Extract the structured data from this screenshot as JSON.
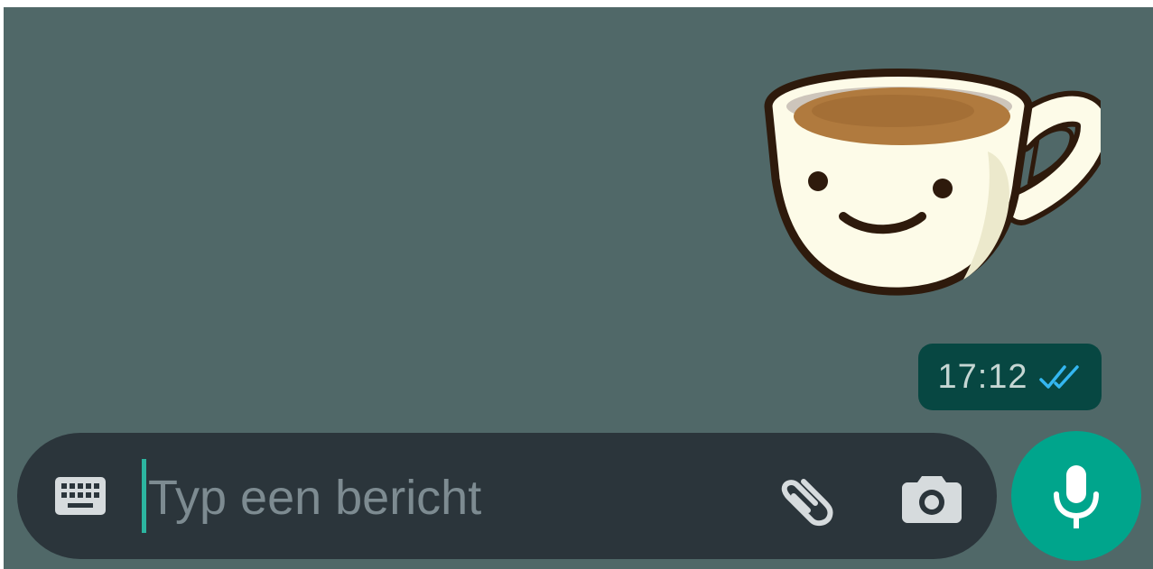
{
  "colors": {
    "chat_background": "#506868",
    "bubble_background": "#074742",
    "input_background": "#2b353b",
    "accent": "#00a58c",
    "read_ticks": "#34b7f1"
  },
  "conversation": {
    "sticker": {
      "icon": "coffee-cup-sticker"
    },
    "message_meta": {
      "time": "17:12",
      "status_icon": "double-check-read-icon"
    }
  },
  "composer": {
    "keyboard_icon": "keyboard-icon",
    "input_placeholder": "Typ een bericht",
    "attach_icon": "paperclip-icon",
    "camera_icon": "camera-icon",
    "mic_icon": "microphone-icon"
  }
}
